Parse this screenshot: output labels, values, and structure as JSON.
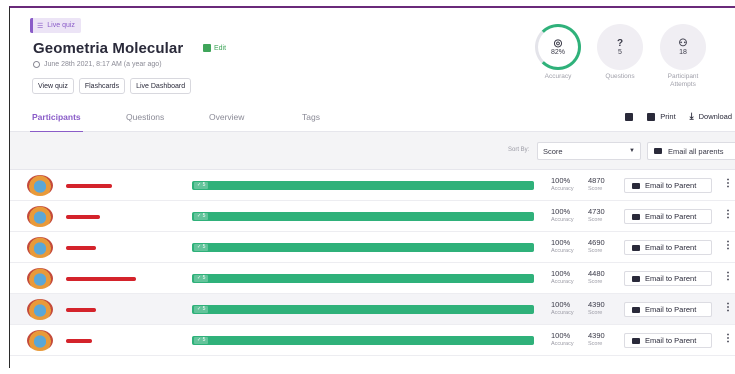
{
  "quiz": {
    "badge": "Live quiz",
    "title": "Geometria Molecular",
    "edit_label": "Edit",
    "date": "June 28th 2021, 8:17 AM (a year ago)",
    "buttons": [
      "View quiz",
      "Flashcards",
      "Live Dashboard"
    ]
  },
  "stats": {
    "accuracy": {
      "value": "82%",
      "label": "Accuracy",
      "percent": 82
    },
    "questions": {
      "value": "5",
      "label": "Questions"
    },
    "attempts": {
      "value": "18",
      "label": "Participant Attempts"
    }
  },
  "tabs": [
    "Participants",
    "Questions",
    "Overview",
    "Tags"
  ],
  "tab_tools": {
    "print": "Print",
    "download": "Download"
  },
  "sort": {
    "label": "Sort By:",
    "value": "Score",
    "email_all": "Email all parents"
  },
  "participants": [
    {
      "correct": "5",
      "accuracy": "100%",
      "accuracy_label": "Accuracy",
      "score": "4870",
      "score_label": "Score",
      "email": "Email to Parent"
    },
    {
      "correct": "5",
      "accuracy": "100%",
      "accuracy_label": "Accuracy",
      "score": "4730",
      "score_label": "Score",
      "email": "Email to Parent"
    },
    {
      "correct": "5",
      "accuracy": "100%",
      "accuracy_label": "Accuracy",
      "score": "4690",
      "score_label": "Score",
      "email": "Email to Parent"
    },
    {
      "correct": "5",
      "accuracy": "100%",
      "accuracy_label": "Accuracy",
      "score": "4480",
      "score_label": "Score",
      "email": "Email to Parent"
    },
    {
      "correct": "5",
      "accuracy": "100%",
      "accuracy_label": "Accuracy",
      "score": "4390",
      "score_label": "Score",
      "email": "Email to Parent"
    },
    {
      "correct": "5",
      "accuracy": "100%",
      "accuracy_label": "Accuracy",
      "score": "4390",
      "score_label": "Score",
      "email": "Email to Parent"
    }
  ],
  "colors": {
    "accent": "#8a5cc8",
    "success": "#2fb17a",
    "redacted": "#d4232b"
  }
}
